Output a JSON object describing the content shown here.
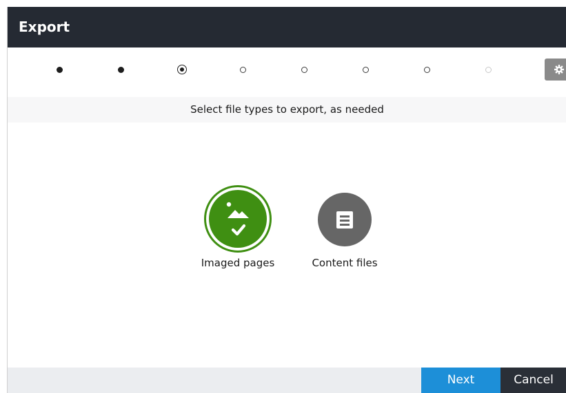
{
  "dialog": {
    "title": "Export"
  },
  "wizard": {
    "steps": [
      {
        "state": "completed"
      },
      {
        "state": "completed"
      },
      {
        "state": "current"
      },
      {
        "state": "pending"
      },
      {
        "state": "pending"
      },
      {
        "state": "pending"
      },
      {
        "state": "pending"
      },
      {
        "state": "disabled"
      }
    ],
    "settings_icon": "gear-icon"
  },
  "instruction": "Select file types to export, as needed",
  "file_types": [
    {
      "label": "Imaged pages",
      "selected": true,
      "icon": "image-icon",
      "color": "#3f8f12"
    },
    {
      "label": "Content files",
      "selected": false,
      "icon": "document-icon",
      "color": "#666666"
    }
  ],
  "footer": {
    "next_label": "Next",
    "cancel_label": "Cancel"
  },
  "colors": {
    "titlebar": "#252a33",
    "next_button": "#1d8fd8",
    "cancel_button": "#2a2f37",
    "selected_accent": "#3f8f12"
  }
}
